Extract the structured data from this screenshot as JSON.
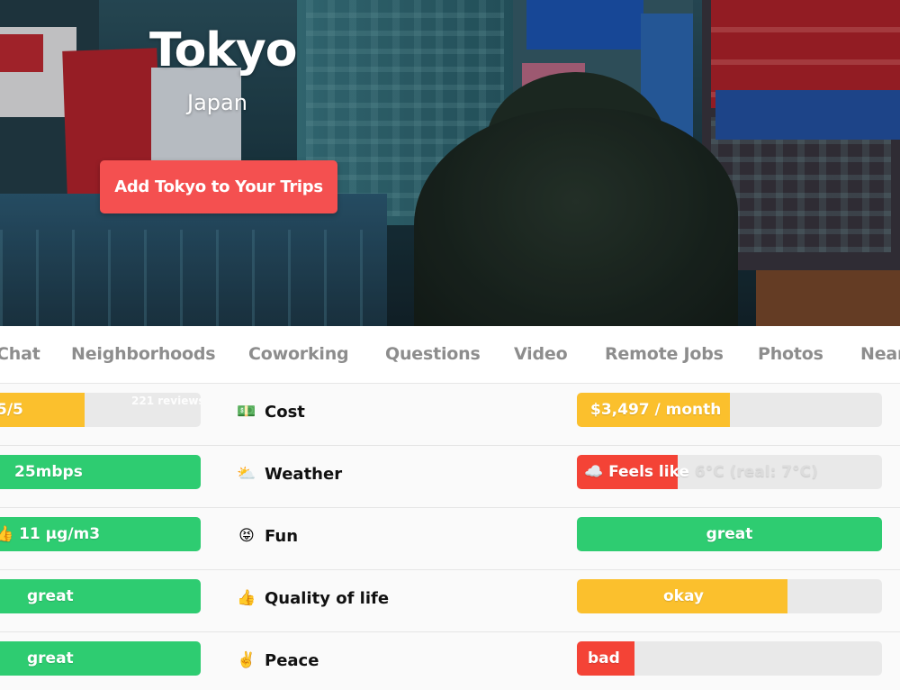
{
  "hero": {
    "title": "Tokyo",
    "subtitle": "Japan",
    "cta_label": "Add Tokyo to Your Trips"
  },
  "tabs": [
    "Chat",
    "Neighborhoods",
    "Coworking",
    "Questions",
    "Video",
    "Remote Jobs",
    "Photos",
    "Near"
  ],
  "left_bars": [
    {
      "text": "5/5",
      "note": "221 reviews",
      "fill_fraction": 0.44,
      "color": "#fbc02d"
    },
    {
      "text": "25mbps",
      "fill_fraction": 1.0,
      "color": "#2ecc71"
    },
    {
      "icon": "thumbs-up",
      "text": "11 μg/m3",
      "fill_fraction": 1.0,
      "color": "#2ecc71"
    },
    {
      "text": "great",
      "fill_fraction": 1.0,
      "color": "#2ecc71"
    },
    {
      "text": "great",
      "fill_fraction": 1.0,
      "color": "#2ecc71"
    }
  ],
  "metrics": [
    {
      "emoji": "💵",
      "emoji_name": "money-icon",
      "label": "Cost",
      "value": "$3,497 / month",
      "fill_fraction": 0.5,
      "color": "#fbc02d"
    },
    {
      "emoji": "⛅",
      "emoji_name": "cloud-sun-icon",
      "label": "Weather",
      "value_main": "☁️ Feels like",
      "value_rest": " 6°C (real: 7°C)",
      "fill_fraction": 0.33,
      "color": "#f44336"
    },
    {
      "emoji": "😝",
      "emoji_name": "tongue-face-icon",
      "label": "Fun",
      "value": "great",
      "fill_fraction": 1.0,
      "color": "#2ecc71"
    },
    {
      "emoji": "👍",
      "emoji_name": "thumbs-up-icon",
      "label": "Quality of life",
      "value": "okay",
      "fill_fraction": 0.69,
      "color": "#fbc02d"
    },
    {
      "emoji": "✌️",
      "emoji_name": "peace-hand-icon",
      "label": "Peace",
      "value": "bad",
      "fill_fraction": 0.19,
      "color": "#f44336"
    }
  ]
}
